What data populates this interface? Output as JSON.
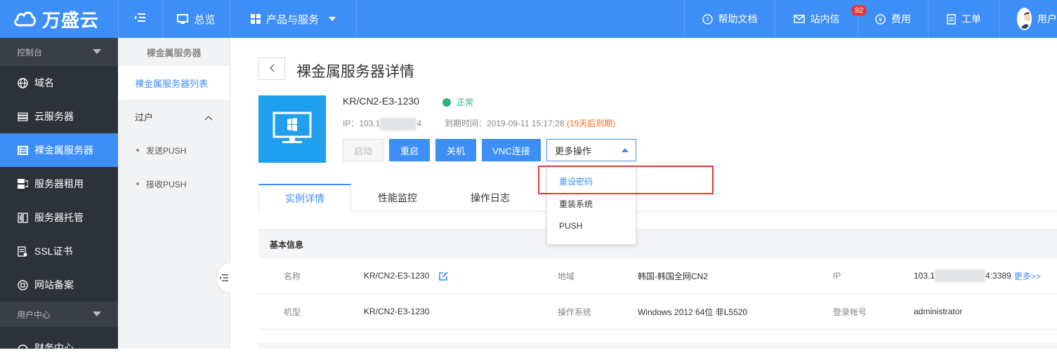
{
  "brand": {
    "name": "万盛云",
    "accent": "#3e8ef7"
  },
  "topnav": {
    "menu_icon": "menu-icon",
    "overview": "总览",
    "products": "产品与服务",
    "help": "帮助文档",
    "messages": "站内信",
    "messages_badge": "92",
    "billing": "费用",
    "ticket": "工单",
    "user": "用户"
  },
  "sidebar": {
    "group1": "控制台",
    "items": [
      {
        "label": "域名",
        "icon": "globe-icon"
      },
      {
        "label": "云服务器",
        "icon": "server-stack-icon"
      },
      {
        "label": "裸金属服务器",
        "icon": "list-icon"
      },
      {
        "label": "服务器租用",
        "icon": "rent-icon"
      },
      {
        "label": "服务器托管",
        "icon": "hosting-icon"
      },
      {
        "label": "SSL证书",
        "icon": "certificate-icon"
      },
      {
        "label": "网站备案",
        "icon": "record-icon"
      }
    ],
    "group2": "用户中心",
    "finance": "财务中心"
  },
  "subsidebar": {
    "title": "裸金属服务器",
    "link": "裸金属服务器列表",
    "group": "过户",
    "subs": [
      "发送PUSH",
      "接收PUSH"
    ]
  },
  "main": {
    "title": "裸金属服务器详情",
    "server_name": "KR/CN2-E3-1230",
    "status": "正常",
    "ip_prefix": "IP：103.1",
    "ip_suffix": "4",
    "expire_label": "到期时间：2019-09-11 15:17:28",
    "expire_warn": "(19天后到期)",
    "buttons": {
      "start": "启动",
      "restart": "重启",
      "shutdown": "关机",
      "vnc": "VNC连接",
      "more": "更多操作"
    },
    "dropdown": [
      "重设密码",
      "重装系统",
      "PUSH"
    ],
    "tabs": [
      "实例详情",
      "性能监控",
      "操作日志"
    ],
    "section": "基本信息",
    "rows": [
      {
        "l1": "名称",
        "v1": "KR/CN2-E3-1230",
        "l2": "地域",
        "v2": "韩国-韩国全网CN2",
        "l3": "IP",
        "v3_prefix": "103.1",
        "v3_suffix": "4:3389",
        "v3_more": "更多>>"
      },
      {
        "l1": "机型",
        "v1": "KR/CN2-E3-1230",
        "l2": "操作系统",
        "v2": "Windows 2012 64位 非L5520",
        "l3": "登录帐号",
        "v3": "administrator"
      }
    ]
  }
}
